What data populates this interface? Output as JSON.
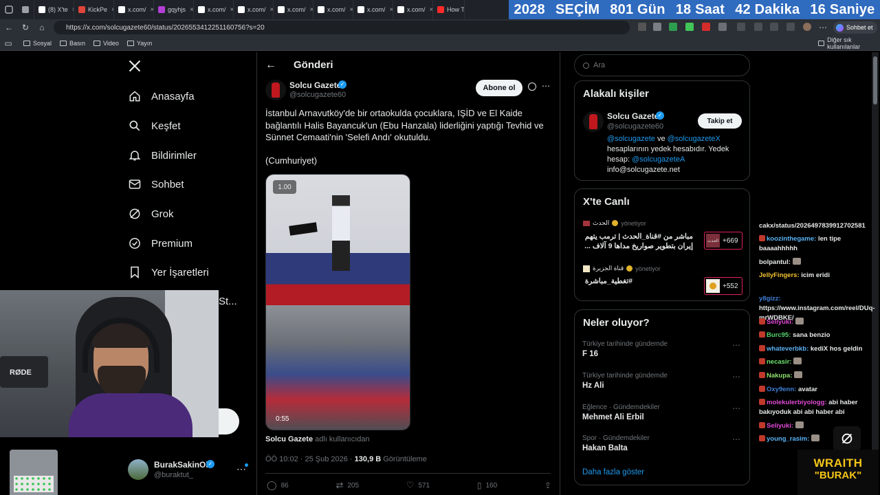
{
  "browser": {
    "tabs": [
      {
        "label": "",
        "color": "#9aa0a6"
      },
      {
        "label": "(8) X'te",
        "color": "#ffffff"
      },
      {
        "label": "KickPe",
        "color": "#e0443a"
      },
      {
        "label": "x.com/",
        "color": "#ffffff"
      },
      {
        "label": "gqyhjs",
        "color": "#b43fd6"
      },
      {
        "label": "x.com/",
        "color": "#ffffff"
      },
      {
        "label": "x.com/",
        "color": "#ffffff"
      },
      {
        "label": "x.com/",
        "color": "#ffffff"
      },
      {
        "label": "x.com/",
        "color": "#ffffff"
      },
      {
        "label": "x.com/",
        "color": "#ffffff"
      },
      {
        "label": "x.com/",
        "color": "#ffffff"
      },
      {
        "label": "How To",
        "color": "#ff2a2a"
      }
    ],
    "url": "https://x.com/solcugazete60/status/2026553412251160756?s=20",
    "bookmarks": [
      "Sosyal",
      "Basın",
      "Video",
      "Yayın"
    ],
    "other_bookmarks": "Diğer sık kullanılanlar",
    "copilot_label": "Sohbet et"
  },
  "countdown": {
    "year": "2028",
    "label": "SEÇİM",
    "days": "801 Gün",
    "hours": "18 Saat",
    "minutes": "42 Dakika",
    "seconds": "16 Saniye"
  },
  "sidebar": {
    "items": [
      {
        "label": "Anasayfa",
        "icon": "home-icon"
      },
      {
        "label": "Keşfet",
        "icon": "search-icon"
      },
      {
        "label": "Bildirimler",
        "icon": "bell-icon"
      },
      {
        "label": "Sohbet",
        "icon": "mail-icon"
      },
      {
        "label": "Grok",
        "icon": "grok-icon"
      },
      {
        "label": "Premium",
        "icon": "verified-icon"
      },
      {
        "label": "Yer İşaretleri",
        "icon": "bookmark-icon"
      },
      {
        "label": "St...",
        "icon": ""
      }
    ],
    "account": {
      "name": "BurakSakinOl",
      "handle": "@buraktut_"
    }
  },
  "post": {
    "header": "Gönderi",
    "author_name": "Solcu Gazete",
    "author_handle": "@solcugazete60",
    "subscribe_label": "Abone ol",
    "text": "İstanbul Arnavutköy'de bir ortaokulda çocuklara, IŞİD ve El Kaide bağlantılı Halis Bayancuk'un (Ebu Hanzala) liderliğini yaptığı Tevhid ve Sünnet Cemaati'nin 'Selefi Andı' okutuldu.",
    "source": "(Cumhuriyet)",
    "video_speed": "1.00",
    "video_time": "0:55",
    "attribution_name": "Solcu Gazete",
    "attribution_suffix": "adlı kullanıcıdan",
    "timestamp": "ÖÖ 10:02 · 25 Şub 2026 ·",
    "views_count": "130,9 B",
    "views_label": "Görüntüleme",
    "stats": {
      "replies": "86",
      "reposts": "205",
      "likes": "571",
      "bookmarks": "160"
    }
  },
  "search": {
    "placeholder": "Ara"
  },
  "related": {
    "title": "Alakalı kişiler",
    "name": "Solcu Gazete",
    "handle": "@solcugazete60",
    "follow_label": "Takip et",
    "bio_link1": "@solcugazete",
    "bio_and": "ve",
    "bio_link2": "@solcugazeteX",
    "bio_text": "hesaplarının yedek hesabıdır. Yedek hesap:",
    "bio_link3": "@solcugazeteA",
    "bio_email": "info@solcugazete.net"
  },
  "live": {
    "title": "X'te Canlı",
    "items": [
      {
        "host": "الحدث",
        "status": "yönetiyor",
        "text": "مباشر من #قناة_الحدث | ترمب يتهم إيران بتطوير صواريخ مداها 9 آلاف ...",
        "count": "+669",
        "thumb": "الحدث"
      },
      {
        "host": "قناة الجزيرة",
        "status": "yönetiyor",
        "text": "#تغطية_مباشرة",
        "count": "+552",
        "thumb": ""
      }
    ]
  },
  "trends": {
    "title": "Neler oluyor?",
    "items": [
      {
        "context": "Türkiye tarihinde gündemde",
        "name": "F 16"
      },
      {
        "context": "Türkiye tarihinde gündemde",
        "name": "Hz Ali"
      },
      {
        "context": "Eğlence · Gündemdekiler",
        "name": "Mehmet Ali Erbil"
      },
      {
        "context": "Spor · Gündemdekiler",
        "name": "Hakan Balta"
      }
    ],
    "show_more": "Daha fazla göster"
  },
  "chat": [
    {
      "user": "",
      "msg": "cakx/status/2026497839912702581",
      "color": "#e7e9ea"
    },
    {
      "user": "koozinthegame:",
      "msg": "len tipe baaaahhhhh",
      "color": "#5ab3f5"
    },
    {
      "user": "bolpantul:",
      "msg": "",
      "color": "#e7e9ea"
    },
    {
      "user": "JellyFingers:",
      "msg": "icim eridi",
      "color": "#f4c430"
    },
    {
      "user": "y8gizz:",
      "msg": "https://www.instagram.com/reel/DUq-mrWDBKE/",
      "color": "#3f7fd6"
    },
    {
      "user": "Seliyuki:",
      "msg": "",
      "color": "#e04ad6"
    },
    {
      "user": "Burc95:",
      "msg": "sana benzio",
      "color": "#55d36b"
    },
    {
      "user": "whateverbkb:",
      "msg": "kediX hos geldin",
      "color": "#5ab3f5"
    },
    {
      "user": "necasir:",
      "msg": "",
      "color": "#6fe36f"
    },
    {
      "user": "Nakupa:",
      "msg": "",
      "color": "#8fe36f"
    },
    {
      "user": "Oxy9enn:",
      "msg": "avatar",
      "color": "#3f7fd6"
    },
    {
      "user": "molekulerbiyologg:",
      "msg": "abi haber bakıyoduk abi abi haber abi",
      "color": "#e04ad6"
    },
    {
      "user": "Seliyuki:",
      "msg": "",
      "color": "#e04ad6"
    },
    {
      "user": "young_rasim:",
      "msg": "",
      "color": "#5ab3f5"
    }
  ],
  "overlay": {
    "mic_brand": "RØDE",
    "logo_line1": "WRAITH",
    "logo_line2": "\"BURAK\""
  }
}
